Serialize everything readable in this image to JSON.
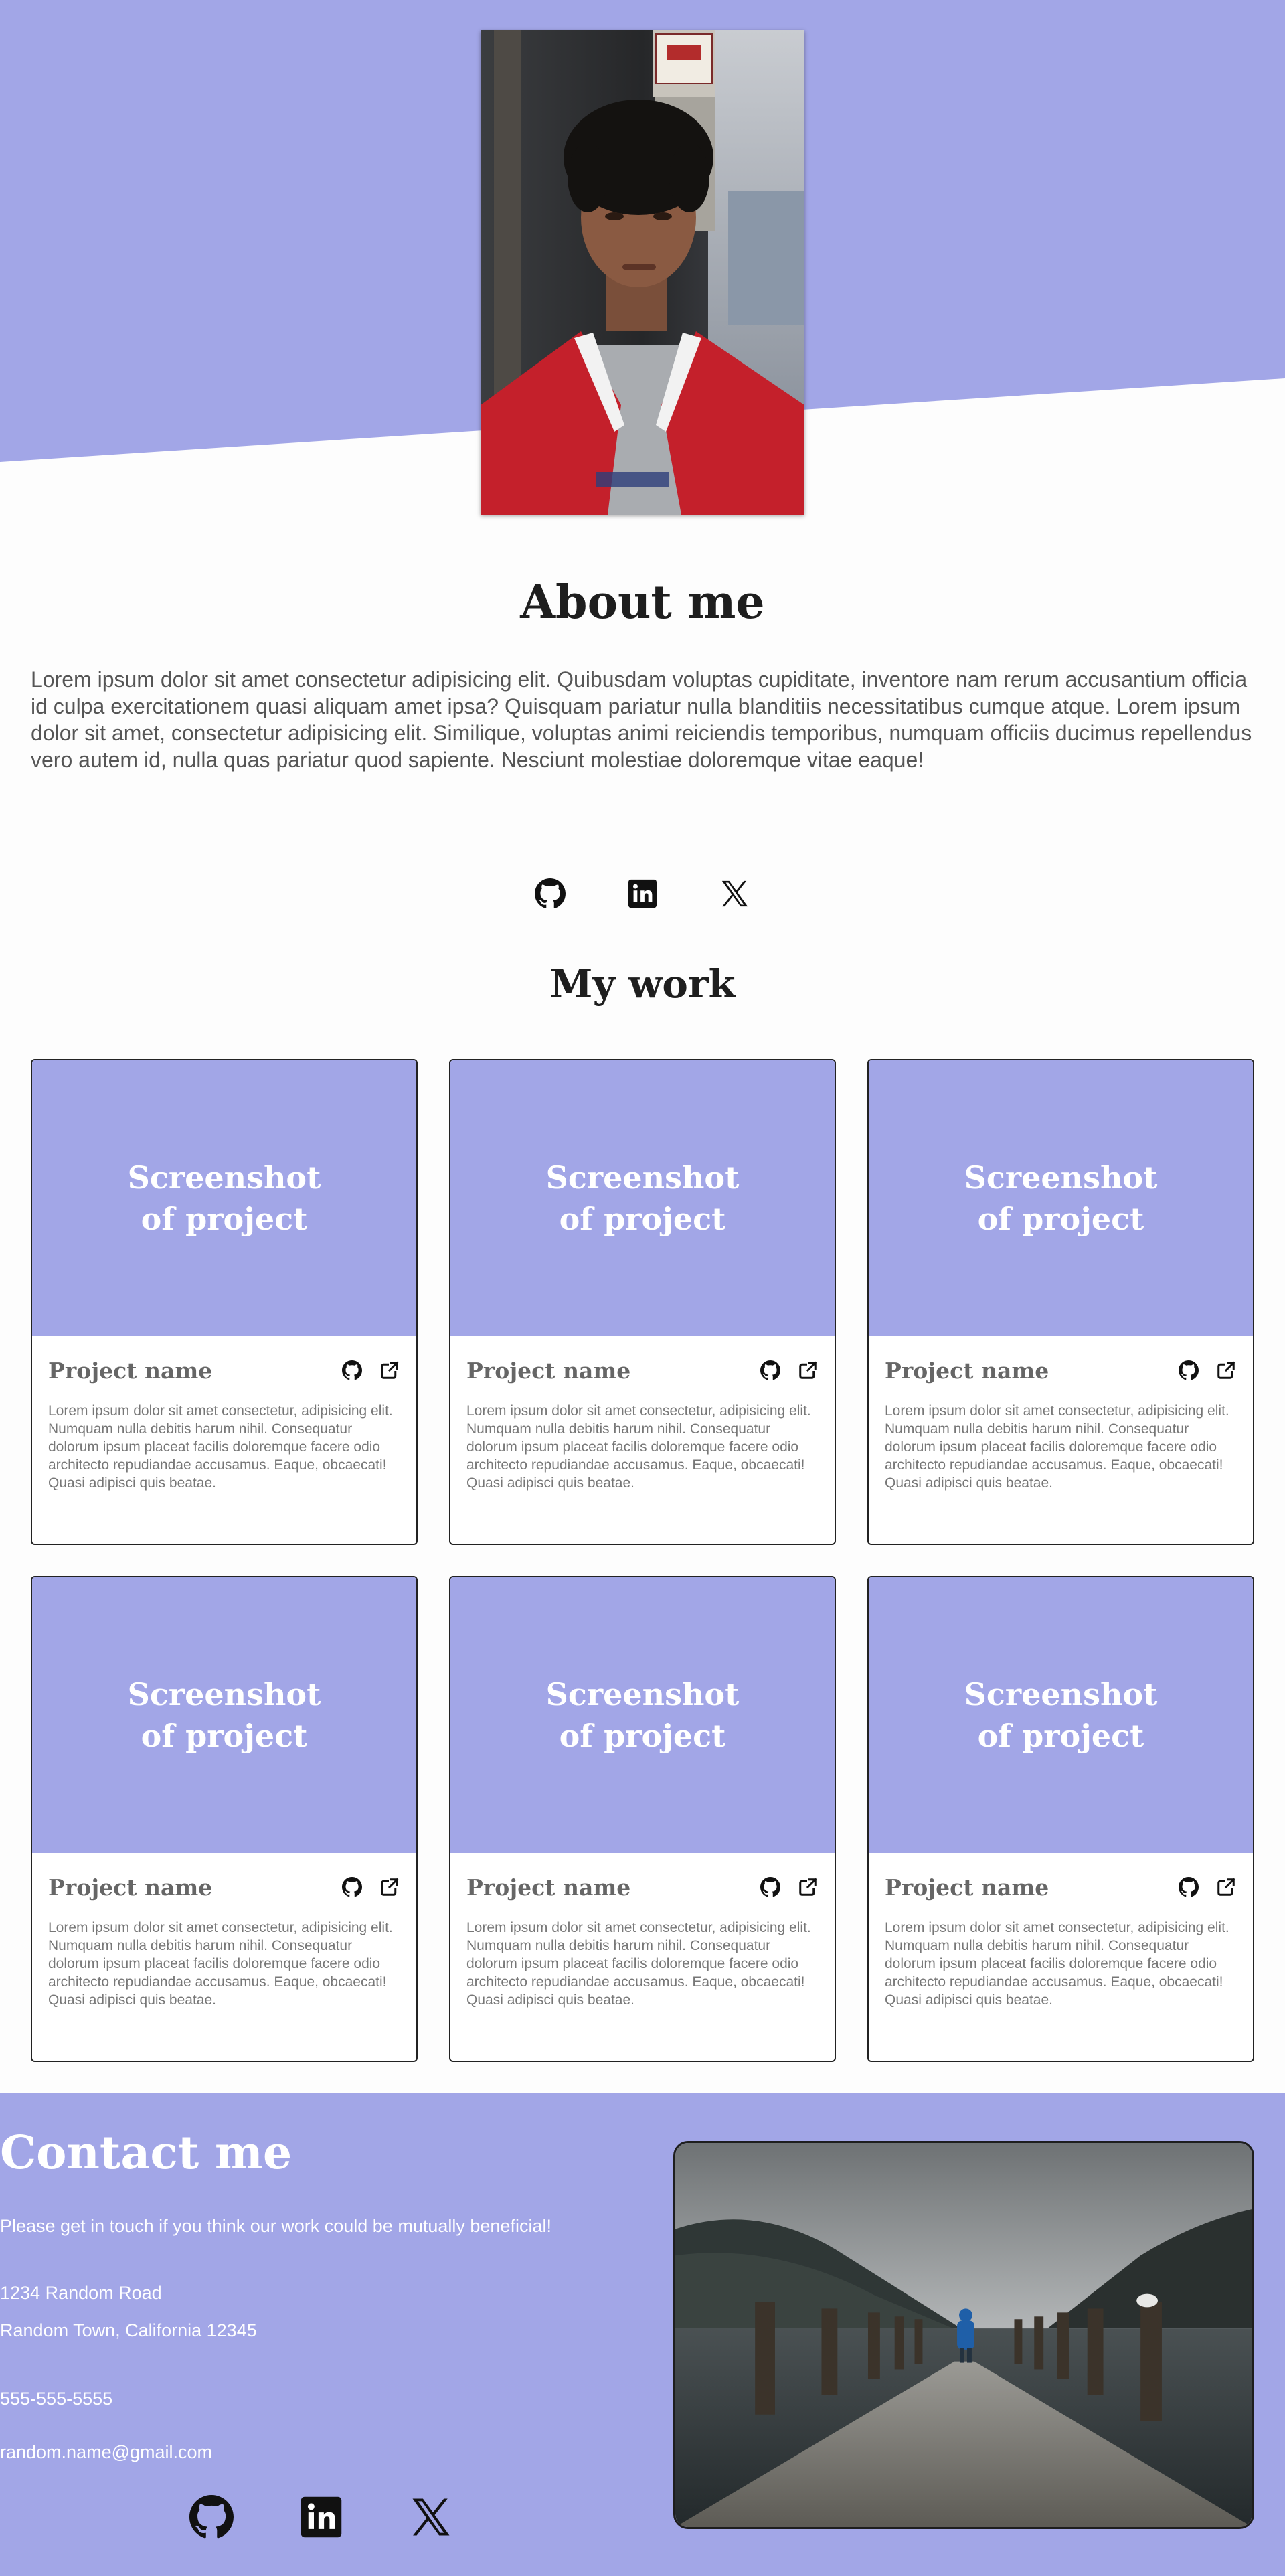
{
  "colors": {
    "accent": "#a2a6e7",
    "heading": "#1e1e1e",
    "body_text": "#555555"
  },
  "profile": {
    "image": "portrait-photo"
  },
  "about": {
    "title": "About me",
    "text": "Lorem ipsum dolor sit amet consectetur adipisicing elit. Quibusdam voluptas cupiditate, inventore nam rerum accusantium officia id culpa exercitationem quasi aliquam amet ipsa? Quisquam pariatur nulla blanditiis necessitatibus cumque atque. Lorem ipsum dolor sit amet, consectetur adipisicing elit. Similique, voluptas animi reiciendis temporibus, numquam officiis ducimus repellendus vero autem id, nulla quas pariatur quod sapiente. Nesciunt molestiae doloremque vitae eaque!"
  },
  "social": [
    "github-icon",
    "linkedin-icon",
    "x-icon"
  ],
  "work": {
    "title": "My work",
    "projects": [
      {
        "screenshot_label": "Screenshot of project",
        "name": "Project name",
        "description": "Lorem ipsum dolor sit amet consectetur, adipisicing elit. Numquam nulla debitis harum nihil. Consequatur dolorum ipsum placeat facilis doloremque facere odio architecto repudiandae accusamus. Eaque, obcaecati! Quasi adipisci quis beatae."
      },
      {
        "screenshot_label": "Screenshot of project",
        "name": "Project name",
        "description": "Lorem ipsum dolor sit amet consectetur, adipisicing elit. Numquam nulla debitis harum nihil. Consequatur dolorum ipsum placeat facilis doloremque facere odio architecto repudiandae accusamus. Eaque, obcaecati! Quasi adipisci quis beatae."
      },
      {
        "screenshot_label": "Screenshot of project",
        "name": "Project name",
        "description": "Lorem ipsum dolor sit amet consectetur, adipisicing elit. Numquam nulla debitis harum nihil. Consequatur dolorum ipsum placeat facilis doloremque facere odio architecto repudiandae accusamus. Eaque, obcaecati! Quasi adipisci quis beatae."
      },
      {
        "screenshot_label": "Screenshot of project",
        "name": "Project name",
        "description": "Lorem ipsum dolor sit amet consectetur, adipisicing elit. Numquam nulla debitis harum nihil. Consequatur dolorum ipsum placeat facilis doloremque facere odio architecto repudiandae accusamus. Eaque, obcaecati! Quasi adipisci quis beatae."
      },
      {
        "screenshot_label": "Screenshot of project",
        "name": "Project name",
        "description": "Lorem ipsum dolor sit amet consectetur, adipisicing elit. Numquam nulla debitis harum nihil. Consequatur dolorum ipsum placeat facilis doloremque facere odio architecto repudiandae accusamus. Eaque, obcaecati! Quasi adipisci quis beatae."
      },
      {
        "screenshot_label": "Screenshot of project",
        "name": "Project name",
        "description": "Lorem ipsum dolor sit amet consectetur, adipisicing elit. Numquam nulla debitis harum nihil. Consequatur dolorum ipsum placeat facilis doloremque facere odio architecto repudiandae accusamus. Eaque, obcaecati! Quasi adipisci quis beatae."
      }
    ]
  },
  "contact": {
    "title": "Contact me",
    "invite": "Please get in touch if you think our work could be mutually beneficial!",
    "address_line1": "1234 Random Road",
    "address_line2": "Random Town, California 12345",
    "phone": "555-555-5555",
    "email": "random.name@gmail.com",
    "image": "pier-lake-photo"
  }
}
